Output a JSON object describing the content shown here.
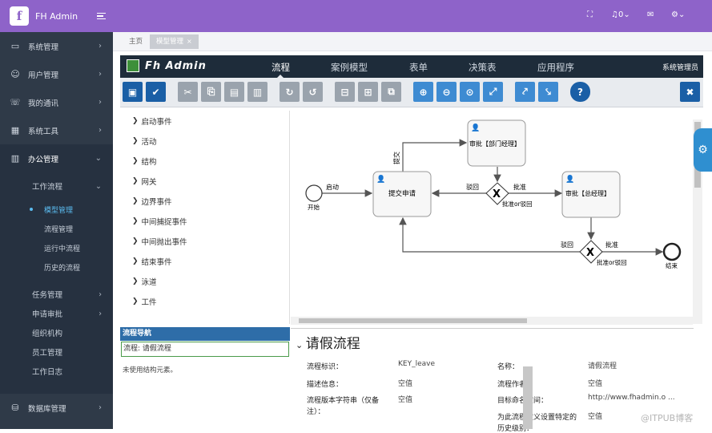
{
  "app": {
    "name": "FH Admin",
    "logo_letter": "f"
  },
  "sidebar": {
    "items": [
      {
        "label": "系统管理",
        "icon": "monitor-icon"
      },
      {
        "label": "用户管理",
        "icon": "users-icon"
      },
      {
        "label": "我的通讯",
        "icon": "phone-icon"
      },
      {
        "label": "系统工具",
        "icon": "grid-icon"
      },
      {
        "label": "办公管理",
        "icon": "columns-icon"
      }
    ],
    "office": {
      "workflow": "工作流程",
      "workflow_items": [
        "模型管理",
        "流程管理",
        "运行中流程",
        "历史的流程"
      ],
      "groups": [
        "任务管理",
        "申请审批"
      ],
      "plain": [
        "组织机构",
        "员工管理",
        "工作日志"
      ]
    },
    "db": {
      "label": "数据库管理",
      "icon": "database-icon"
    }
  },
  "topbar": {
    "badge": "0"
  },
  "tabs": {
    "home": "主页",
    "active": "模型管理"
  },
  "editor": {
    "brand": "Fh Admin",
    "nav": [
      "流程",
      "案例模型",
      "表单",
      "决策表",
      "应用程序"
    ],
    "user": "系统管理员",
    "palette": [
      "启动事件",
      "活动",
      "结构",
      "网关",
      "边界事件",
      "中间捕捉事件",
      "中间抛出事件",
      "结束事件",
      "泳道",
      "工件"
    ],
    "nav_panel": {
      "title": "流程导航",
      "item": "流程: 请假流程",
      "note": "未使用结构元素。"
    }
  },
  "diagram": {
    "start": "开始",
    "start_flow": "启动",
    "submit_task": "提交申请",
    "submit_flow": "提交",
    "dept_task": "审批【部门经理】",
    "reject1": "驳回",
    "approve1": "批准",
    "gw1_label": "批准or驳回",
    "gm_task": "审批【总经理】",
    "reject2": "驳回",
    "approve2": "批准",
    "gw2_label": "批准or驳回",
    "end": "结束"
  },
  "props": {
    "title": "请假流程",
    "fields": [
      {
        "label": "流程标识：",
        "value": "KEY_leave"
      },
      {
        "label": "名称：",
        "value": "请假流程"
      },
      {
        "label": "描述信息：",
        "value": "空值"
      },
      {
        "label": "流程作者：",
        "value": "空值"
      },
      {
        "label": "流程版本字符串（仅备",
        "label2": "注）：",
        "value": "空值"
      },
      {
        "label": "目标命名空间：",
        "value": "http://www.fhadmin.o ..."
      },
      {
        "label": "为此流程定义设置特定的",
        "label2": "历史级别：",
        "value": "空值"
      }
    ]
  },
  "watermark": "@ITPUB博客",
  "colors": {
    "purple": "#8e63c9",
    "sidebar": "#2f3a48",
    "toolbar_blue": "#1a5fa6",
    "accent": "#5bbcf0"
  }
}
